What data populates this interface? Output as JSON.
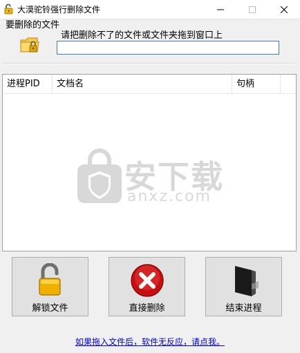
{
  "window": {
    "title": "大漠驼铃强行删除文件",
    "icon": "lock-icon"
  },
  "file_section": {
    "label": "要删除的文件",
    "hint": "请把删除不了的文件或文件夹拖到窗口上",
    "input_value": "",
    "icon": "folder-lock-icon"
  },
  "table": {
    "columns": [
      "进程PID",
      "文档名",
      "句柄"
    ],
    "rows": []
  },
  "watermark": {
    "main": "安下载",
    "sub": "anxz.com"
  },
  "actions": {
    "unlock_label": "解锁文件",
    "delete_label": "直接删除",
    "kill_label": "结束进程"
  },
  "footer": {
    "help_link": "如果拖入文件后，软件无反应，请点我。"
  }
}
